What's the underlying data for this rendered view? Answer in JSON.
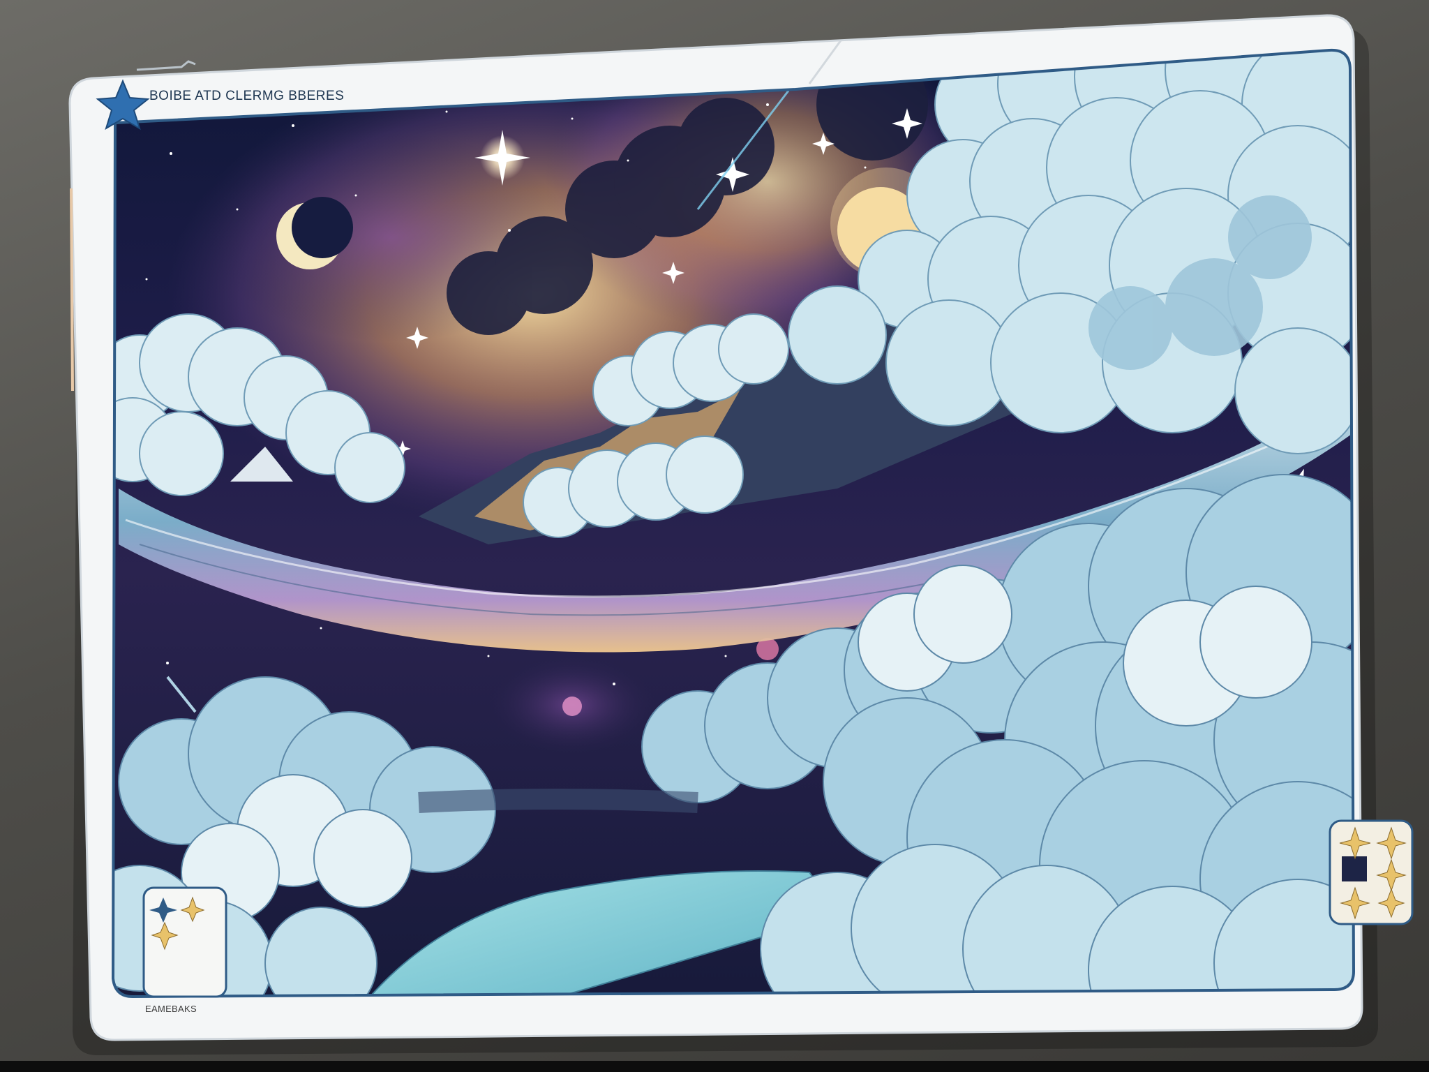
{
  "card": {
    "title": "BOIBE ATD CLERMG BBERES",
    "footer_label": "EAMEBAKS"
  },
  "icons": {
    "header": "star-icon",
    "corner_left": "sparkle-icon",
    "corner_right": "sparkle-icon"
  },
  "colors": {
    "card_frame": "#f4f6f7",
    "frame_accent": "#2f6fb0",
    "night_sky": "#161a3c",
    "cloud": "#b6dbe9",
    "moon": "#f2e2b0",
    "glow": "#f6c56e"
  }
}
